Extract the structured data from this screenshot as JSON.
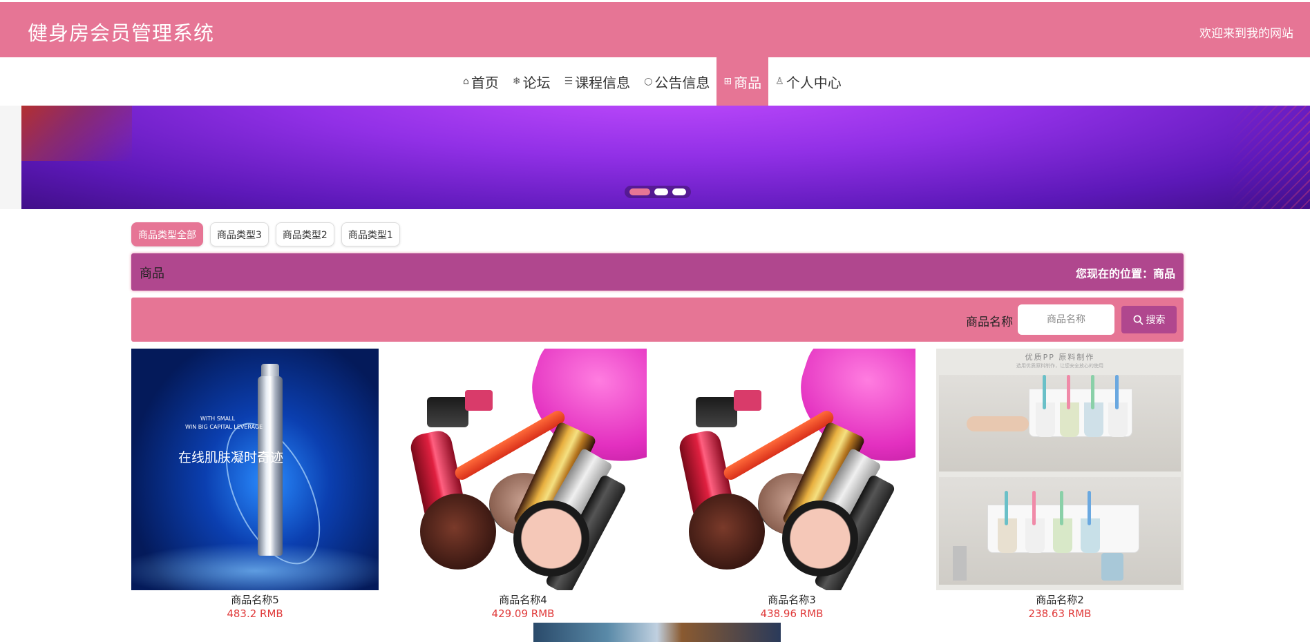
{
  "header": {
    "title": "健身房会员管理系统",
    "welcome": "欢迎来到我的网站"
  },
  "nav": {
    "items": [
      {
        "label": "首页",
        "icon": "home-icon",
        "glyph": "⌂"
      },
      {
        "label": "论坛",
        "icon": "snowflake-icon",
        "glyph": "❄"
      },
      {
        "label": "课程信息",
        "icon": "layers-icon",
        "glyph": "☰"
      },
      {
        "label": "公告信息",
        "icon": "notice-icon",
        "glyph": "○"
      },
      {
        "label": "商品",
        "icon": "gift-icon",
        "glyph": "⊞"
      },
      {
        "label": "个人中心",
        "icon": "user-icon",
        "glyph": "♙"
      }
    ],
    "active_index": 4
  },
  "banner": {
    "slide_count": 3,
    "active_slide": 1
  },
  "categories": {
    "items": [
      "商品类型全部",
      "商品类型3",
      "商品类型2",
      "商品类型1"
    ],
    "active_index": 0
  },
  "section": {
    "title": "商品",
    "location_prefix": "您现在的位置：",
    "location": "商品"
  },
  "search": {
    "label": "商品名称",
    "placeholder": "商品名称",
    "value": "",
    "button_label": "搜索"
  },
  "products": [
    {
      "name": "商品名称5",
      "price": "483.2 RMB"
    },
    {
      "name": "商品名称4",
      "price": "429.09 RMB"
    },
    {
      "name": "商品名称3",
      "price": "438.96 RMB"
    },
    {
      "name": "商品名称2",
      "price": "238.63 RMB"
    }
  ],
  "product_image_text": {
    "serum_line1": "WITH SMALL",
    "serum_line2": "WIN BIG CAPITAL LEVERAGE",
    "serum_big": "在线肌肤凝时奇迹",
    "holder_head": "优质PP 原料制作",
    "holder_sub": "选用优质原料制作，让您安全放心的使用"
  },
  "colors": {
    "primary": "#e67595",
    "secondary": "#b0478e",
    "price": "#e03a3a"
  }
}
